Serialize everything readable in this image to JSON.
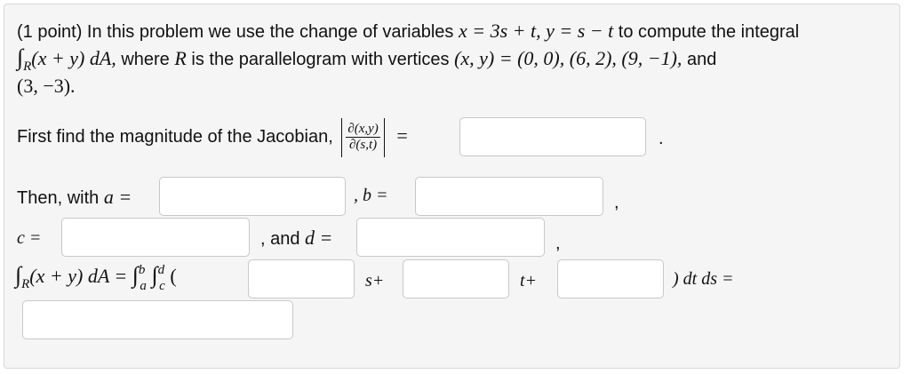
{
  "problem": {
    "points": "(1 point) In this problem we use the change of variables",
    "cov_x": "x = 3s + t, y = s − t",
    "to_compute": "to compute the integral",
    "integral_lhs": "(x + y) dA,",
    "where": "where",
    "R": "R",
    "parallelogram": "is the parallelogram with vertices",
    "vertices_eq": "(x, y) = (0, 0), (6, 2), (9, −1),",
    "and": "and",
    "last_vertex": "(3, −3)."
  },
  "jacobian": {
    "label": "First find the magnitude of the Jacobian,",
    "numerator": "∂(x,y)",
    "denominator": "∂(s,t)",
    "equals": "=",
    "period": "."
  },
  "limits": {
    "then_with": "Then, with",
    "a_eq": "a =",
    "b_eq": ", b =",
    "comma": ",",
    "c_eq": "c =",
    "and_d": ", and",
    "d_eq": "d ="
  },
  "final": {
    "lhs": "(x + y) dA =",
    "b": "b",
    "a": "a",
    "d": "d",
    "c": "c",
    "open_paren": "(",
    "s_plus": "s+",
    "t_plus": "t+",
    "close": ") dt ds ="
  }
}
